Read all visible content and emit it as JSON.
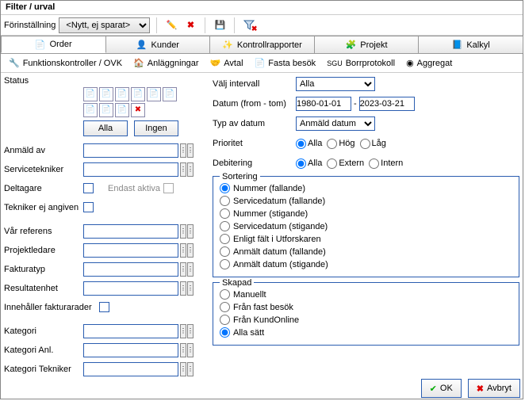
{
  "window": {
    "title": "Filter / urval"
  },
  "presets": {
    "label": "Förinställning",
    "value": "<Nytt, ej sparat>"
  },
  "tabs": {
    "order": "Order",
    "kunder": "Kunder",
    "kontrollrapporter": "Kontrollrapporter",
    "projekt": "Projekt",
    "kalkyl": "Kalkyl"
  },
  "subtabs": {
    "funktionskontroller": "Funktionskontroller / OVK",
    "anlaggningar": "Anläggningar",
    "avtal": "Avtal",
    "fastabesok": "Fasta besök",
    "borrprotokoll": "Borrprotokoll",
    "aggregat": "Aggregat",
    "sgu": "SGU"
  },
  "left": {
    "status": "Status",
    "alla_btn": "Alla",
    "ingen_btn": "Ingen",
    "anmald_av": "Anmäld av",
    "servicetekniker": "Servicetekniker",
    "deltagare": "Deltagare",
    "endast_aktiva": "Endast aktiva",
    "tekniker_ej": "Tekniker ej angiven",
    "var_referens": "Vår referens",
    "projektledare": "Projektledare",
    "fakturatyp": "Fakturatyp",
    "resultatenhet": "Resultatenhet",
    "innehaller_fr": "Innehåller fakturarader",
    "kategori": "Kategori",
    "kategori_anl": "Kategori Anl.",
    "kategori_tek": "Kategori Tekniker"
  },
  "right": {
    "valj_intervall": "Välj intervall",
    "intervall_val": "Alla",
    "datum": "Datum  (from - tom)",
    "datum_from": "1980-01-01",
    "datum_tom": "2023-03-21",
    "datum_sep": "-",
    "typ_av_datum": "Typ av datum",
    "typ_val": "Anmäld datum",
    "prioritet": "Prioritet",
    "pr_alla": "Alla",
    "pr_hog": "Hög",
    "pr_lag": "Låg",
    "debitering": "Debitering",
    "deb_alla": "Alla",
    "deb_extern": "Extern",
    "deb_intern": "Intern"
  },
  "sortering": {
    "legend": "Sortering",
    "o1": "Nummer (fallande)",
    "o2": "Servicedatum (fallande)",
    "o3": "Nummer (stigande)",
    "o4": "Servicedatum (stigande)",
    "o5": "Enligt fält i Utforskaren",
    "o6": "Anmält datum (fallande)",
    "o7": "Anmält datum (stigande)"
  },
  "skapad": {
    "legend": "Skapad",
    "o1": "Manuellt",
    "o2": "Från fast besök",
    "o3": "Från KundOnline",
    "o4": "Alla sätt"
  },
  "footer": {
    "ok": "OK",
    "avbryt": "Avbryt"
  }
}
